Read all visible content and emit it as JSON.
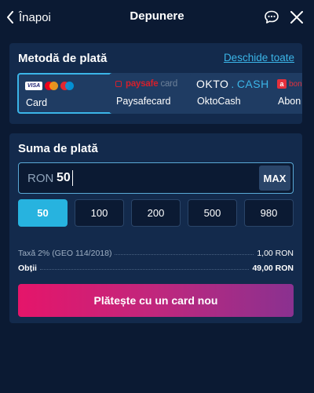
{
  "header": {
    "back_label": "Înapoi",
    "title": "Depunere"
  },
  "payment_method": {
    "title": "Metodă de plată",
    "show_all_link": "Deschide toate",
    "methods": [
      {
        "label": "Card",
        "logo": "visa-mastercard-maestro-logo",
        "logo_text": "VISA",
        "selected": true
      },
      {
        "label": "Paysafecard",
        "logo": "paysafecard-logo",
        "logo_parts": [
          "paysafe",
          "card"
        ],
        "selected": false
      },
      {
        "label": "OktoCash",
        "logo": "oktocash-logo",
        "logo_parts": [
          "OKTO",
          ".",
          "CASH"
        ],
        "selected": false
      },
      {
        "label": "Abon",
        "logo": "abon-logo",
        "logo_parts": [
          "a",
          "bon"
        ],
        "selected": false
      }
    ]
  },
  "amount": {
    "title": "Suma de plată",
    "currency": "RON",
    "value": "50",
    "max_label": "MAX",
    "presets": [
      "50",
      "100",
      "200",
      "500",
      "980"
    ],
    "selected_preset": "50",
    "fee_label": "Taxă 2% (GEO 114/2018)",
    "fee_value": "1,00 RON",
    "total_label": "Obții",
    "total_value": "49,00 RON",
    "submit_label": "Plătește cu un card nou"
  },
  "colors": {
    "background": "#0b1a33",
    "panel": "#132a4c",
    "accent": "#3bb5e8",
    "active_preset": "#27b3df",
    "button_gradient_start": "#e5156a",
    "button_gradient_end": "#8a3190"
  }
}
